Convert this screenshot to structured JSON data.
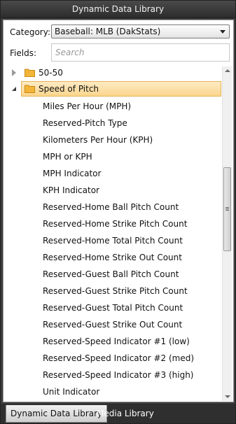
{
  "window": {
    "title": "Dynamic Data Library"
  },
  "form": {
    "category_label": "Category:",
    "category_value": "Baseball: MLB (DakStats)",
    "fields_label": "Fields:",
    "search_placeholder": "Search"
  },
  "tree": {
    "collapsed_folder": "50-50",
    "selected_folder": "Speed of Pitch",
    "items": [
      "Miles Per Hour (MPH)",
      "Reserved-Pitch Type",
      "Kilometers Per Hour (KPH)",
      "MPH or KPH",
      "MPH Indicator",
      "KPH Indicator",
      "Reserved-Home Ball Pitch Count",
      "Reserved-Home Strike Pitch Count",
      "Reserved-Home Total Pitch Count",
      "Reserved-Home Strike Out Count",
      "Reserved-Guest Ball Pitch Count",
      "Reserved-Guest Strike Pitch Count",
      "Reserved-Guest Total Pitch Count",
      "Reserved-Guest Strike Out Count",
      "Reserved-Speed Indicator #1 (low)",
      "Reserved-Speed Indicator #2 (med)",
      "Reserved-Speed Indicator #3 (high)",
      "Unit Indicator"
    ]
  },
  "tabs": [
    {
      "label": "Dynamic Data Library"
    },
    {
      "label": "Media Library"
    }
  ],
  "colors": {
    "selection_fill": "#fbd58c",
    "folder": "#f2b53a"
  }
}
